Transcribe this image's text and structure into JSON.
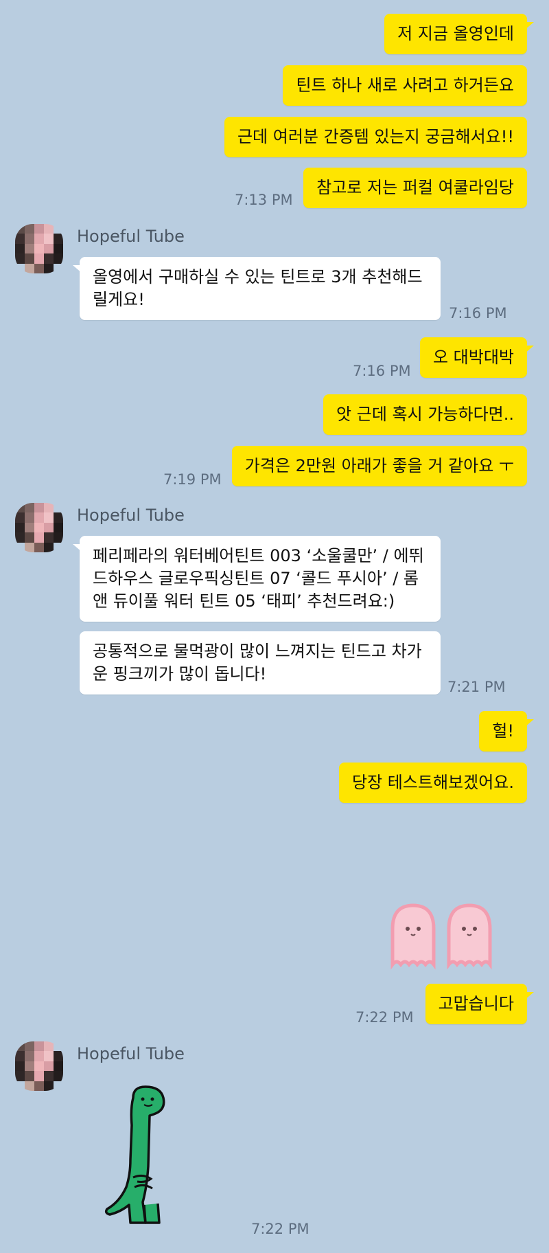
{
  "contact": {
    "name": "Hopeful Tube"
  },
  "messages": {
    "m1": "저 지금 올영인데",
    "m2": "틴트 하나 새로 사려고 하거든요",
    "m3": "근데 여러분 간증템 있는지 궁금해서요!!",
    "m4": "참고로 저는 퍼컬 여쿨라임당",
    "t1": "7:13 PM",
    "r1": "올영에서 구매하실 수 있는 틴트로 3개 추천해드릴게요!",
    "t2": "7:16 PM",
    "m5": "오 대박대박",
    "t3": "7:16 PM",
    "m6": "앗 근데 혹시 가능하다면..",
    "m7": "가격은 2만원 아래가 좋을 거 같아요 ㅜ",
    "t4": "7:19 PM",
    "r2": "페리페라의 워터베어틴트 003 ‘소울쿨만’ / 에뛰드하우스 글로우픽싱틴트 07 ‘콜드 푸시아’ / 롬앤 듀이풀 워터 틴트 05 ‘태피’ 추천드려요:)",
    "r3": "공통적으로 물먹광이 많이 느껴지는 틴드고 차가운 핑크끼가 많이 돕니다!",
    "t5": "7:21 PM",
    "m8": "헐!",
    "m9": "당장 테스트해보겠어요.",
    "m10": "고맙습니다",
    "t6": "7:22 PM",
    "t7": "7:22 PM"
  },
  "stickers": {
    "ghosts": "pink-ghosts-sticker",
    "dino": "green-dinosaur-sticker"
  },
  "colors": {
    "background": "#b9cde0",
    "my_bubble": "#fee500",
    "their_bubble": "#ffffff"
  }
}
